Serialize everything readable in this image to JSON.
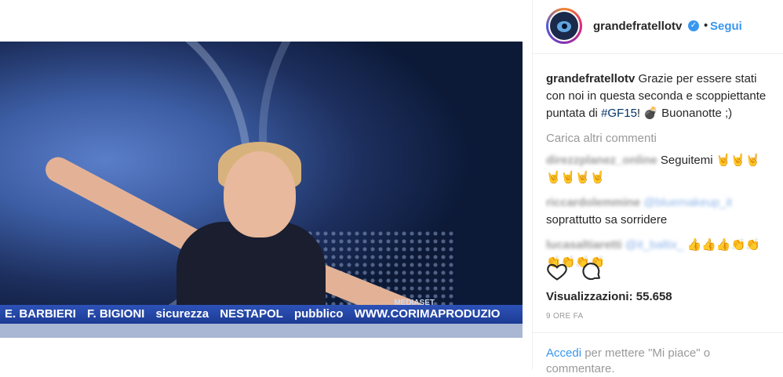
{
  "video": {
    "ticker": [
      "E. BARBIERI",
      "F. BIGIONI",
      "sicurezza",
      "NESTAPOL",
      "pubblico",
      "WWW.CORIMAPRODUZIO"
    ],
    "watermark": "MEDIASET"
  },
  "header": {
    "username": "grandefratellotv",
    "verified_icon": "verified-badge-icon",
    "separator": "•",
    "follow_label": "Segui"
  },
  "caption": {
    "username": "grandefratellotv",
    "text_before_tag": "Grazie per essere stati con noi in questa seconda e scoppiettante puntata di ",
    "hashtag": "#GF15",
    "text_after_tag": "! 💣 Buonanotte ;)"
  },
  "load_more": "Carica altri commenti",
  "comments": [
    {
      "username": "direzzplanez_online",
      "text": "Seguitemi 🤘🤘🤘🤘🤘🤘🤘"
    },
    {
      "username": "riccardolemmine",
      "mention": "@bluemakeup_it",
      "text": "soprattutto sa sorridere"
    },
    {
      "username": "lucasaltiaretti",
      "mention": "@it_baltix_",
      "text": " 👍👍👍👏👏👏👏👏👏"
    }
  ],
  "actions": {
    "like_icon": "heart-icon",
    "comment_icon": "comment-icon"
  },
  "views": {
    "label": "Visualizzazioni:",
    "count": "55.658"
  },
  "time": "9 ORE FA",
  "login": {
    "link": "Accedi",
    "rest": " per mettere \"Mi piace\" o commentare."
  }
}
